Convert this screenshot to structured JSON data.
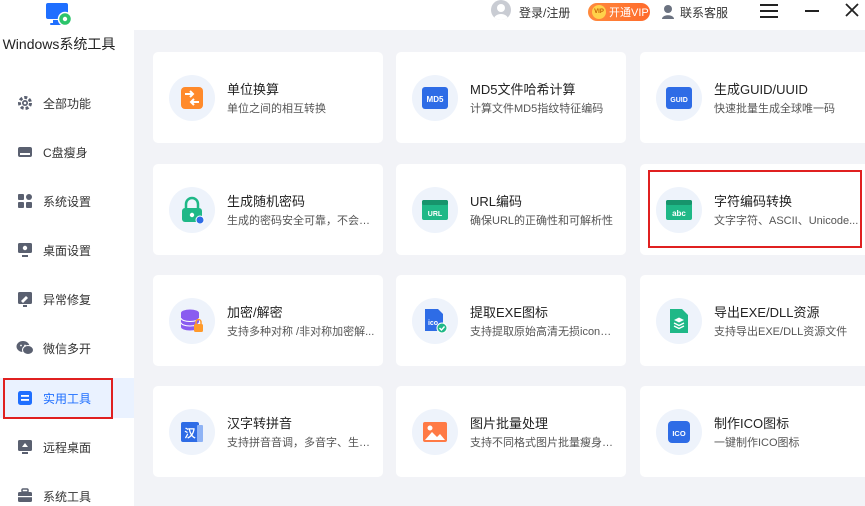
{
  "app": {
    "title": "Windows系统工具"
  },
  "header": {
    "login_label": "登录/注册",
    "vip_label": "开通VIP",
    "vip_badge": "VIP",
    "service_label": "联系客服"
  },
  "sidebar": {
    "items": [
      {
        "label": "全部功能",
        "icon": "gear-icon"
      },
      {
        "label": "C盘瘦身",
        "icon": "disk-icon"
      },
      {
        "label": "系统设置",
        "icon": "grid-icon"
      },
      {
        "label": "桌面设置",
        "icon": "monitor-icon"
      },
      {
        "label": "异常修复",
        "icon": "repair-icon"
      },
      {
        "label": "微信多开",
        "icon": "wechat-icon"
      },
      {
        "label": "实用工具",
        "icon": "toolbox-icon",
        "active": true
      },
      {
        "label": "远程桌面",
        "icon": "remote-icon"
      },
      {
        "label": "系统工具",
        "icon": "briefcase-icon"
      }
    ]
  },
  "cards": [
    {
      "title": "单位换算",
      "desc": "单位之间的相互转换",
      "icon": "unit-convert-icon",
      "icon_text": ""
    },
    {
      "title": "MD5文件哈希计算",
      "desc": "计算文件MD5指纹特征编码",
      "icon": "md5-icon",
      "icon_text": "MD5"
    },
    {
      "title": "生成GUID/UUID",
      "desc": "快速批量生成全球唯一码",
      "icon": "guid-icon",
      "icon_text": "GUID"
    },
    {
      "title": "生成随机密码",
      "desc": "生成的密码安全可靠，不会存...",
      "icon": "lock-icon",
      "icon_text": ""
    },
    {
      "title": "URL编码",
      "desc": "确保URL的正确性和可解析性",
      "icon": "url-icon",
      "icon_text": "URL"
    },
    {
      "title": "字符编码转换",
      "desc": "文字字符、ASCII、Unicode...",
      "icon": "abc-icon",
      "icon_text": "abc"
    },
    {
      "title": "加密/解密",
      "desc": "支持多种对称 /非对称加密解...",
      "icon": "database-lock-icon",
      "icon_text": ""
    },
    {
      "title": "提取EXE图标",
      "desc": "支持提取原始高清无损icon图...",
      "icon": "ico-extract-icon",
      "icon_text": "ico"
    },
    {
      "title": "导出EXE/DLL资源",
      "desc": "支持导出EXE/DLL资源文件",
      "icon": "layers-file-icon",
      "icon_text": ""
    },
    {
      "title": "汉字转拼音",
      "desc": "支持拼音音调，多音字、生僻...",
      "icon": "pinyin-icon",
      "icon_text": "汉"
    },
    {
      "title": "图片批量处理",
      "desc": "支持不同格式图片批量瘦身、...",
      "icon": "image-icon",
      "icon_text": ""
    },
    {
      "title": "制作ICO图标",
      "desc": "一键制作ICO图标",
      "icon": "ico-make-icon",
      "icon_text": "ICO"
    }
  ],
  "colors": {
    "accent": "#1f6fff",
    "highlight_box": "#e02020",
    "vip": "#ff7a33"
  }
}
